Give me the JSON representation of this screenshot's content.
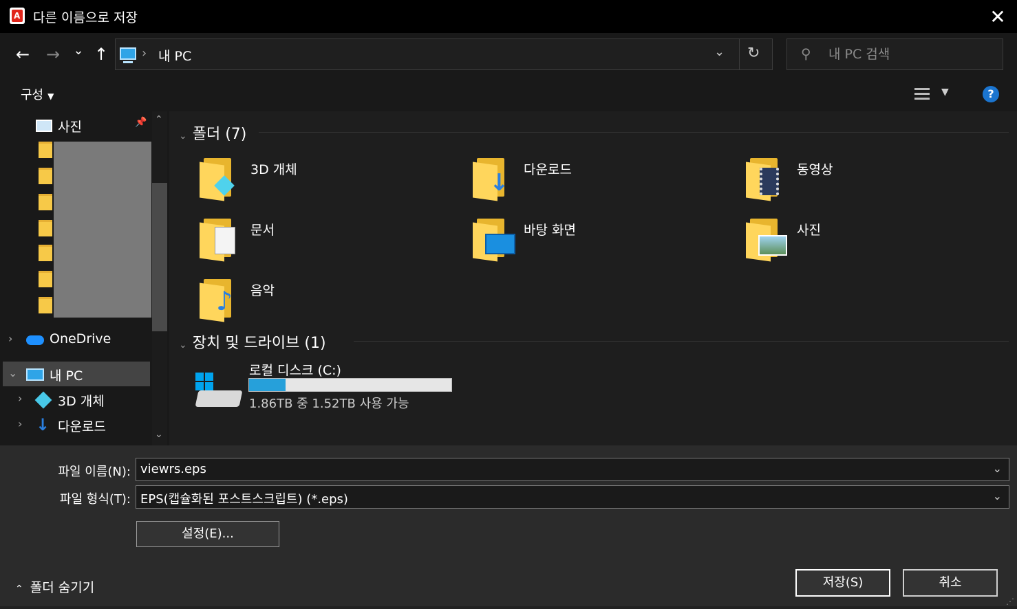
{
  "window": {
    "title": "다른 이름으로 저장",
    "app_icon_letter": "A",
    "close_glyph": "✕"
  },
  "nav": {
    "back_glyph": "←",
    "forward_glyph": "→",
    "recent_glyph": "⌄",
    "up_glyph": "↑",
    "address_sep": "›",
    "address_crumb": "내 PC",
    "address_dropdown_glyph": "⌄",
    "refresh_glyph": "↻",
    "search_icon_glyph": "⚲",
    "search_placeholder": "내 PC 검색"
  },
  "toolbar": {
    "organize_label": "구성",
    "organize_caret": "▼",
    "view_caret": "▼",
    "help_glyph": "?"
  },
  "sidebar": {
    "pinned_label": "사진",
    "pin_glyph": "📌",
    "scroll_up_glyph": "⌃",
    "scroll_down_glyph": "⌄",
    "collapsed_glyph": "›",
    "expanded_glyph": "⌄",
    "items": [
      {
        "label": "OneDrive"
      },
      {
        "label": "내 PC"
      },
      {
        "label": "3D 개체"
      },
      {
        "label": "다운로드"
      }
    ]
  },
  "content": {
    "groups": [
      {
        "chevron": "⌄",
        "title": "폴더 (7)"
      },
      {
        "chevron": "⌄",
        "title": "장치 및 드라이브 (1)"
      }
    ],
    "folders": [
      {
        "label": "3D 개체",
        "icon": "3d-objects-folder-icon"
      },
      {
        "label": "다운로드",
        "icon": "downloads-folder-icon"
      },
      {
        "label": "동영상",
        "icon": "videos-folder-icon"
      },
      {
        "label": "문서",
        "icon": "documents-folder-icon"
      },
      {
        "label": "바탕 화면",
        "icon": "desktop-folder-icon"
      },
      {
        "label": "사진",
        "icon": "pictures-folder-icon"
      },
      {
        "label": "음악",
        "icon": "music-folder-icon"
      }
    ],
    "drive": {
      "label": "로컬 디스크 (C:)",
      "used_fraction": 0.18,
      "info": "1.86TB 중 1.52TB 사용 가능"
    }
  },
  "bottom": {
    "filename_label": "파일 이름(N):",
    "filename_value": "viewrs.eps",
    "filetype_label": "파일 형식(T):",
    "filetype_value": "EPS(캡슐화된 포스트스크립트) (*.eps)",
    "combo_arrow": "⌄",
    "settings_button": "설정(E)...",
    "save_button": "저장(S)",
    "cancel_button": "취소",
    "hide_folders_glyph": "⌃",
    "hide_folders_label": "폴더 숨기기",
    "grip_glyph": "⋰"
  },
  "colors": {
    "accent": "#26a0da",
    "folder": "#ffd65c",
    "selected": "#444444"
  }
}
